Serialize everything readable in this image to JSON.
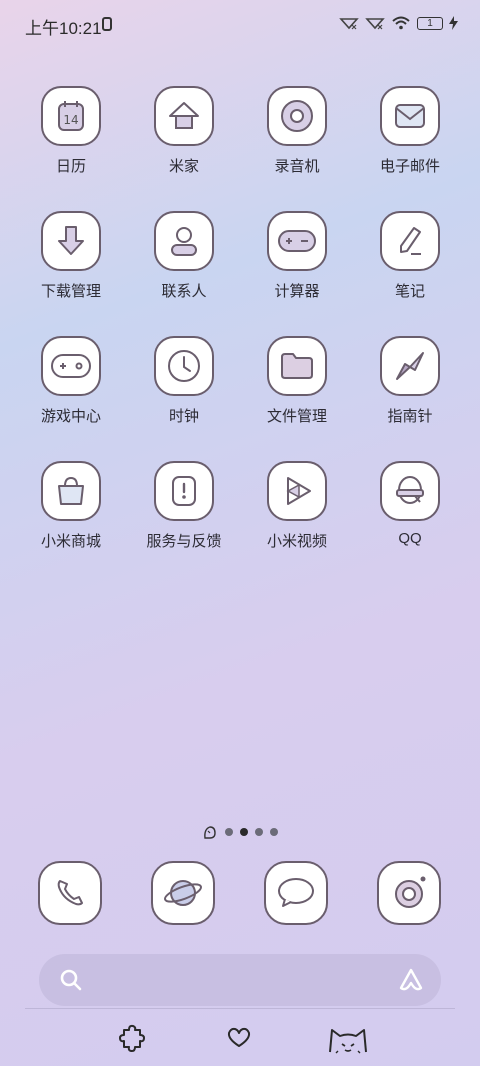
{
  "status": {
    "time": "上午10:21",
    "battery": "1"
  },
  "apps": [
    {
      "label": "日历",
      "icon": "calendar-icon",
      "date": "14"
    },
    {
      "label": "米家",
      "icon": "home-icon"
    },
    {
      "label": "录音机",
      "icon": "recorder-icon"
    },
    {
      "label": "电子邮件",
      "icon": "mail-icon"
    },
    {
      "label": "下载管理",
      "icon": "download-icon"
    },
    {
      "label": "联系人",
      "icon": "contacts-icon"
    },
    {
      "label": "计算器",
      "icon": "calculator-icon"
    },
    {
      "label": "笔记",
      "icon": "notes-icon"
    },
    {
      "label": "游戏中心",
      "icon": "gamepad-icon"
    },
    {
      "label": "时钟",
      "icon": "clock-icon"
    },
    {
      "label": "文件管理",
      "icon": "folder-icon"
    },
    {
      "label": "指南针",
      "icon": "compass-icon"
    },
    {
      "label": "小米商城",
      "icon": "shopping-bag-icon"
    },
    {
      "label": "服务与反馈",
      "icon": "feedback-icon"
    },
    {
      "label": "小米视频",
      "icon": "video-play-icon"
    },
    {
      "label": "QQ",
      "icon": "qq-icon"
    }
  ],
  "page_indicator": {
    "count": 4,
    "active": 1
  },
  "dock": [
    {
      "icon": "phone-icon"
    },
    {
      "icon": "browser-planet-icon"
    },
    {
      "icon": "message-icon"
    },
    {
      "icon": "camera-icon"
    }
  ],
  "search": {
    "placeholder": ""
  },
  "bottom_nav": [
    {
      "icon": "puzzle-icon"
    },
    {
      "icon": "heart-icon"
    },
    {
      "icon": "cat-icon"
    }
  ]
}
